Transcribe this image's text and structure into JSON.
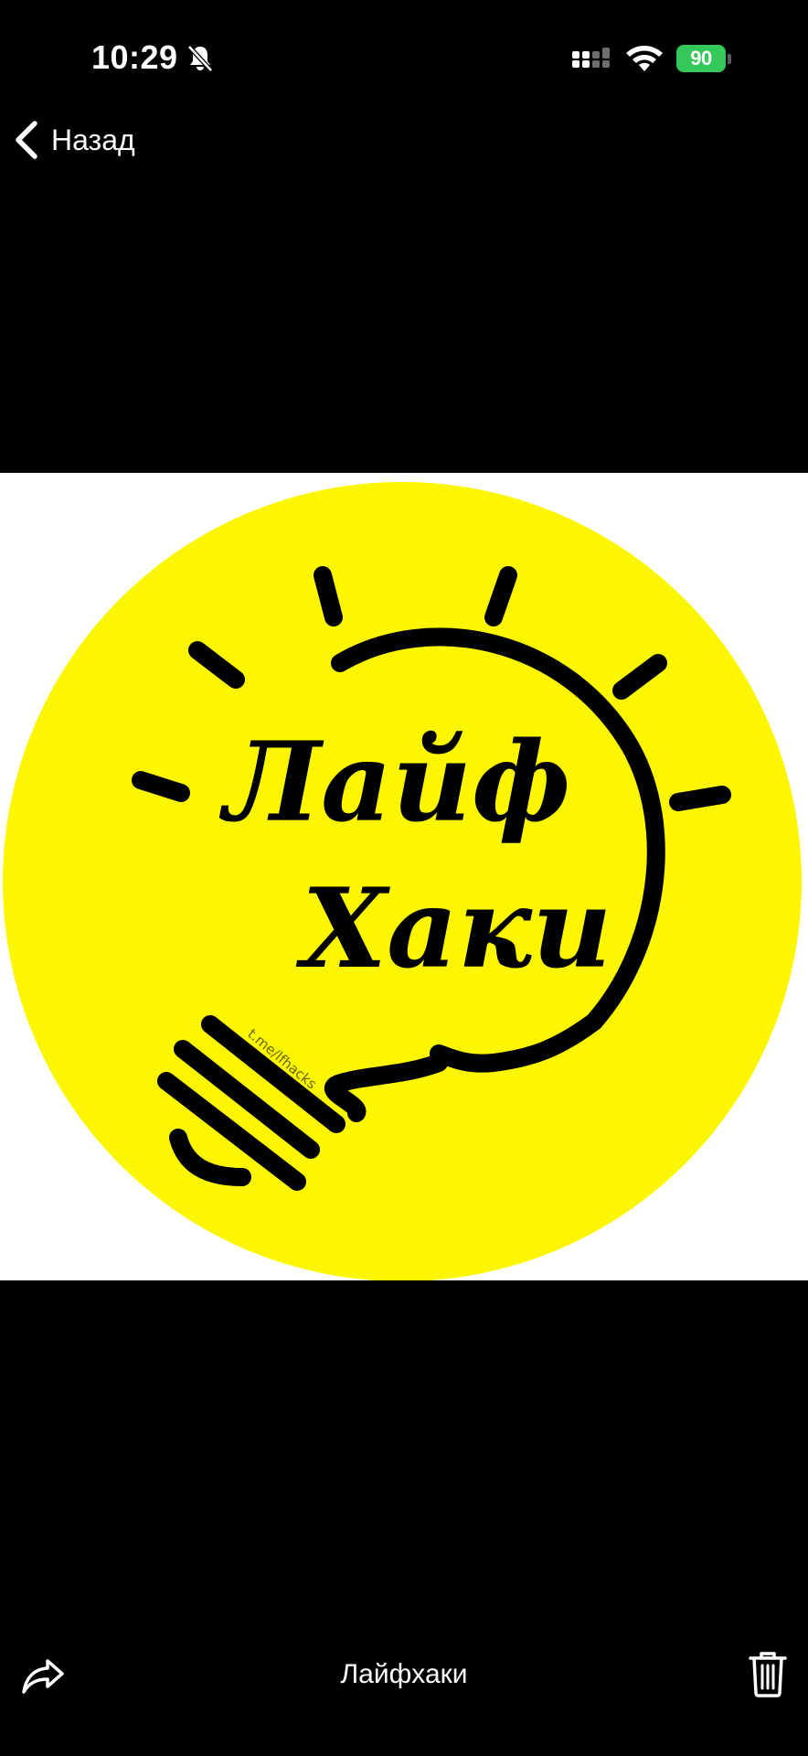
{
  "status_bar": {
    "time": "10:29",
    "battery": "90",
    "battery_color": "#34c759",
    "icons": [
      "bell-slash-icon",
      "signal-icon",
      "wifi-icon",
      "battery-charging-icon"
    ]
  },
  "nav": {
    "back_label": "Назад",
    "back_icon": "chevron-left-icon"
  },
  "image": {
    "logo_text_line1": "Лайф",
    "logo_text_line2": "Хаки",
    "watermark": "t.me/lfhacks",
    "circle_color": "#fcf600",
    "ink_color": "#000000"
  },
  "bottom_bar": {
    "caption": "Лайфхаки",
    "share_icon": "share-arrow-icon",
    "delete_icon": "trash-icon"
  }
}
